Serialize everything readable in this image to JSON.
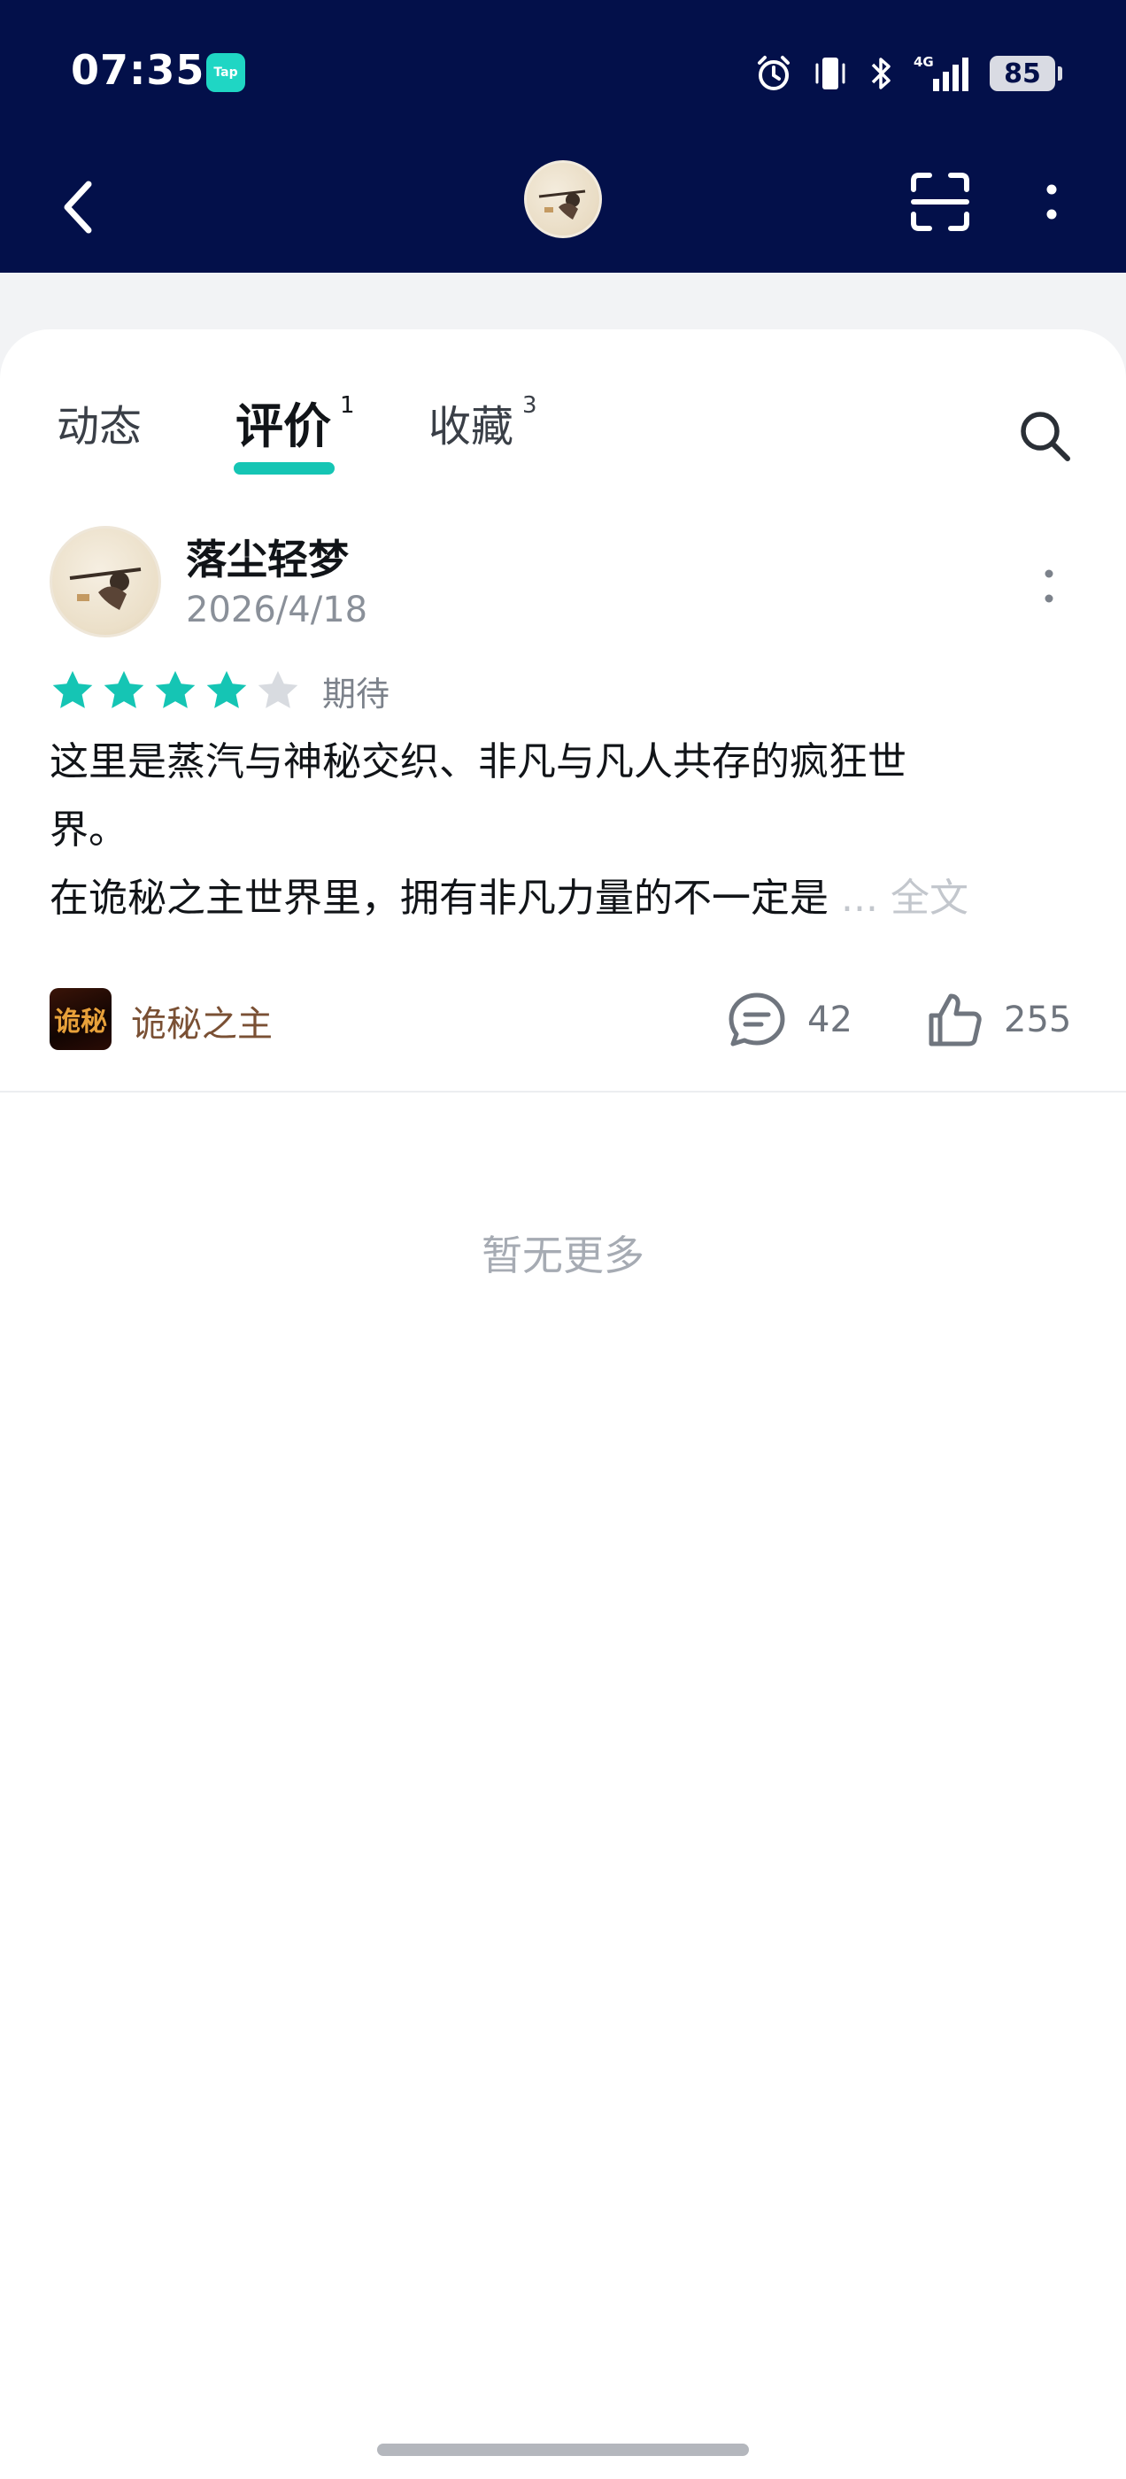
{
  "status_bar": {
    "time": "07:35",
    "app_badge": "Tap",
    "network": "4G",
    "battery": "85",
    "icons": [
      "alarm-icon",
      "vibrate-icon",
      "bluetooth-icon",
      "signal-icon",
      "battery-icon"
    ]
  },
  "nav": {
    "icons": [
      "back-arrow-icon",
      "scan-icon",
      "more-vertical-icon"
    ]
  },
  "tabs": [
    {
      "label": "动态",
      "count": ""
    },
    {
      "label": "评价",
      "count": "1"
    },
    {
      "label": "收藏",
      "count": "3"
    }
  ],
  "active_tab": "评价",
  "review": {
    "user": "落尘轻梦",
    "date": "2026/4/18",
    "rating": 4,
    "max_rating": 5,
    "rating_label": "期待",
    "body_lines": [
      "这里是蒸汽与神秘交织、非凡与凡人共存的疯狂世",
      "界。",
      "在诡秘之主世界里，拥有非凡力量的不一定是"
    ],
    "more_text": "... 全文",
    "game_name": "诡秘之主",
    "game_icon_text": "诡秘",
    "comments": "42",
    "likes": "255"
  },
  "footer_text": "暂无更多",
  "colors": {
    "header_bg": "#03104a",
    "accent": "#15c5b4",
    "game_name": "#7a5034"
  }
}
